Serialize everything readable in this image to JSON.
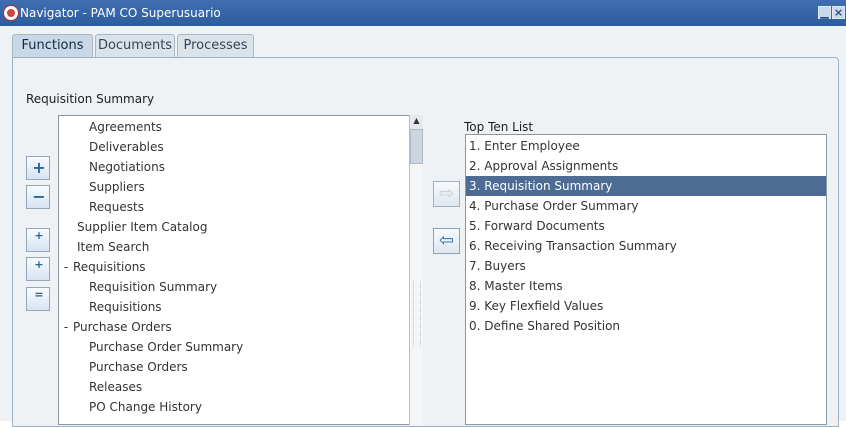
{
  "window": {
    "title": "Navigator - PAM CO Superusuario",
    "minimize_symbol": "▁",
    "close_symbol": "×"
  },
  "tabs": [
    {
      "label": "Functions",
      "active": true
    },
    {
      "label": "Documents",
      "active": false
    },
    {
      "label": "Processes",
      "active": false
    }
  ],
  "section_label": "Requisition Summary",
  "tree": {
    "items": [
      {
        "label": "Agreements",
        "level": 2,
        "expander": ""
      },
      {
        "label": "Deliverables",
        "level": 2,
        "expander": ""
      },
      {
        "label": "Negotiations",
        "level": 2,
        "expander": ""
      },
      {
        "label": "Suppliers",
        "level": 2,
        "expander": ""
      },
      {
        "label": "Requests",
        "level": 2,
        "expander": ""
      },
      {
        "label": "Supplier Item Catalog",
        "level": 1,
        "expander": ""
      },
      {
        "label": "Item Search",
        "level": 1,
        "expander": ""
      },
      {
        "label": "Requisitions",
        "level": 1,
        "expander": "-"
      },
      {
        "label": "Requisition Summary",
        "level": 2,
        "expander": ""
      },
      {
        "label": "Requisitions",
        "level": 2,
        "expander": ""
      },
      {
        "label": "Purchase Orders",
        "level": 1,
        "expander": "-"
      },
      {
        "label": "Purchase Order Summary",
        "level": 2,
        "expander": ""
      },
      {
        "label": "Purchase Orders",
        "level": 2,
        "expander": ""
      },
      {
        "label": "Releases",
        "level": 2,
        "expander": ""
      },
      {
        "label": "PO Change History",
        "level": 2,
        "expander": ""
      }
    ]
  },
  "left_buttons": {
    "expand": {
      "symbol": "+"
    },
    "collapse": {
      "symbol": "−"
    },
    "expand_branch": {
      "symbol": "+"
    },
    "expand_all": {
      "symbol": "+"
    },
    "collapse_all": {
      "symbol": "="
    }
  },
  "transfer": {
    "add_symbol": "⇨",
    "remove_symbol": "⇦",
    "add_disabled": true
  },
  "top_ten": {
    "label": "Top Ten List",
    "selected_index": 2,
    "items": [
      "1. Enter Employee",
      "2. Approval Assignments",
      "3. Requisition Summary",
      "4. Purchase Order Summary",
      "5. Forward Documents",
      "6. Receiving Transaction Summary",
      "7. Buyers",
      "8. Master Items",
      "9. Key Flexfield Values",
      "0. Define Shared Position"
    ]
  },
  "icons": {
    "app_icon": "oracle-app-icon",
    "minimize_icon": "minimize-icon",
    "close_icon": "close-icon",
    "expand_icon": "plus-icon",
    "collapse_icon": "minus-icon",
    "expand_branch_icon": "expand-branch-icon",
    "expand_all_icon": "expand-all-icon",
    "collapse_all_icon": "collapse-all-icon",
    "add_icon": "right-arrow-icon",
    "remove_icon": "left-arrow-icon",
    "scroll_up_icon": "up-arrow-icon"
  },
  "colors": {
    "titlebar": "#2d5d9f",
    "panel": "#eef2f5",
    "selection": "#4d6b93",
    "accent": "#2b6fb5"
  }
}
